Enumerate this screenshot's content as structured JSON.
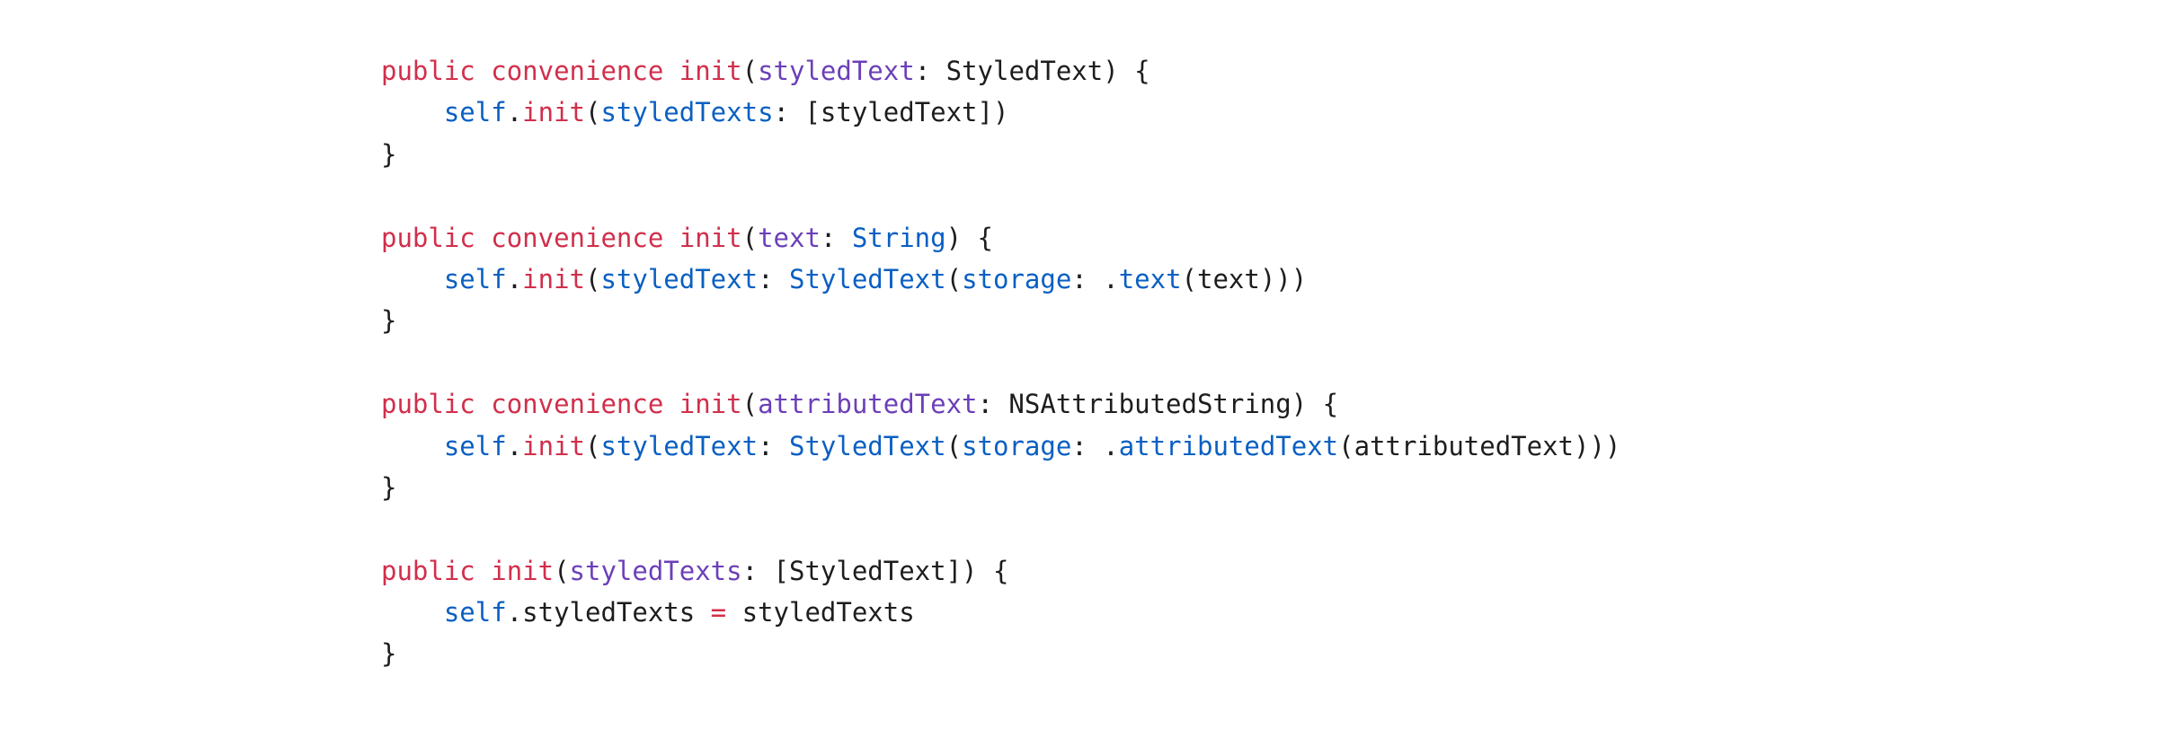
{
  "colors": {
    "keyword": "#d12f4b",
    "parameter": "#6b3fb8",
    "identifier": "#0a5fc2",
    "text": "#1d1d1f",
    "background": "#ffffff"
  },
  "code": {
    "lines": [
      [
        {
          "t": "public",
          "c": "kw"
        },
        {
          "t": " ",
          "c": "plain"
        },
        {
          "t": "convenience",
          "c": "kw"
        },
        {
          "t": " ",
          "c": "plain"
        },
        {
          "t": "init",
          "c": "kw"
        },
        {
          "t": "(",
          "c": "plain"
        },
        {
          "t": "styledText",
          "c": "param"
        },
        {
          "t": ": StyledText) {",
          "c": "plain"
        }
      ],
      [
        {
          "t": "    ",
          "c": "plain"
        },
        {
          "t": "self",
          "c": "ident"
        },
        {
          "t": ".",
          "c": "plain"
        },
        {
          "t": "init",
          "c": "kw"
        },
        {
          "t": "(",
          "c": "plain"
        },
        {
          "t": "styledTexts",
          "c": "ident"
        },
        {
          "t": ": [styledText])",
          "c": "plain"
        }
      ],
      [
        {
          "t": "}",
          "c": "plain"
        }
      ],
      [],
      [
        {
          "t": "public",
          "c": "kw"
        },
        {
          "t": " ",
          "c": "plain"
        },
        {
          "t": "convenience",
          "c": "kw"
        },
        {
          "t": " ",
          "c": "plain"
        },
        {
          "t": "init",
          "c": "kw"
        },
        {
          "t": "(",
          "c": "plain"
        },
        {
          "t": "text",
          "c": "param"
        },
        {
          "t": ": ",
          "c": "plain"
        },
        {
          "t": "String",
          "c": "ident"
        },
        {
          "t": ") {",
          "c": "plain"
        }
      ],
      [
        {
          "t": "    ",
          "c": "plain"
        },
        {
          "t": "self",
          "c": "ident"
        },
        {
          "t": ".",
          "c": "plain"
        },
        {
          "t": "init",
          "c": "kw"
        },
        {
          "t": "(",
          "c": "plain"
        },
        {
          "t": "styledText",
          "c": "ident"
        },
        {
          "t": ": ",
          "c": "plain"
        },
        {
          "t": "StyledText",
          "c": "ident"
        },
        {
          "t": "(",
          "c": "plain"
        },
        {
          "t": "storage",
          "c": "ident"
        },
        {
          "t": ": .",
          "c": "plain"
        },
        {
          "t": "text",
          "c": "ident"
        },
        {
          "t": "(text)))",
          "c": "plain"
        }
      ],
      [
        {
          "t": "}",
          "c": "plain"
        }
      ],
      [],
      [
        {
          "t": "public",
          "c": "kw"
        },
        {
          "t": " ",
          "c": "plain"
        },
        {
          "t": "convenience",
          "c": "kw"
        },
        {
          "t": " ",
          "c": "plain"
        },
        {
          "t": "init",
          "c": "kw"
        },
        {
          "t": "(",
          "c": "plain"
        },
        {
          "t": "attributedText",
          "c": "param"
        },
        {
          "t": ": NSAttributedString) {",
          "c": "plain"
        }
      ],
      [
        {
          "t": "    ",
          "c": "plain"
        },
        {
          "t": "self",
          "c": "ident"
        },
        {
          "t": ".",
          "c": "plain"
        },
        {
          "t": "init",
          "c": "kw"
        },
        {
          "t": "(",
          "c": "plain"
        },
        {
          "t": "styledText",
          "c": "ident"
        },
        {
          "t": ": ",
          "c": "plain"
        },
        {
          "t": "StyledText",
          "c": "ident"
        },
        {
          "t": "(",
          "c": "plain"
        },
        {
          "t": "storage",
          "c": "ident"
        },
        {
          "t": ": .",
          "c": "plain"
        },
        {
          "t": "attributedText",
          "c": "ident"
        },
        {
          "t": "(attributedText)))",
          "c": "plain"
        }
      ],
      [
        {
          "t": "}",
          "c": "plain"
        }
      ],
      [],
      [
        {
          "t": "public",
          "c": "kw"
        },
        {
          "t": " ",
          "c": "plain"
        },
        {
          "t": "init",
          "c": "kw"
        },
        {
          "t": "(",
          "c": "plain"
        },
        {
          "t": "styledTexts",
          "c": "param"
        },
        {
          "t": ": [StyledText]) {",
          "c": "plain"
        }
      ],
      [
        {
          "t": "    ",
          "c": "plain"
        },
        {
          "t": "self",
          "c": "ident"
        },
        {
          "t": ".styledTexts ",
          "c": "plain"
        },
        {
          "t": "=",
          "c": "op"
        },
        {
          "t": " styledTexts",
          "c": "plain"
        }
      ],
      [
        {
          "t": "}",
          "c": "plain"
        }
      ]
    ]
  }
}
